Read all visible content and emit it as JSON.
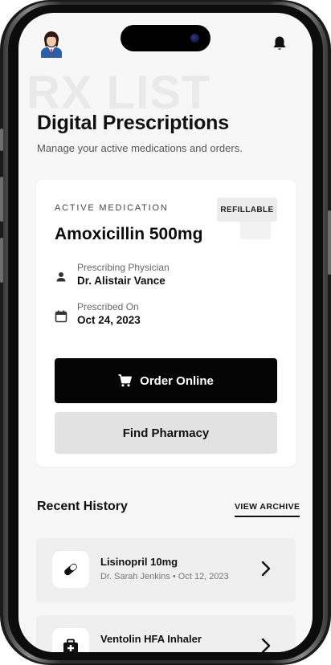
{
  "watermark": "RX LIST",
  "header": {
    "title": "Digital Prescriptions",
    "subtitle": "Manage your active medications and orders."
  },
  "active_card": {
    "eyebrow": "ACTIVE MEDICATION",
    "badge": "REFILLABLE",
    "medication": "Amoxicillin 500mg",
    "physician_label": "Prescribing Physician",
    "physician_value": "Dr. Alistair Vance",
    "date_label": "Prescribed On",
    "date_value": "Oct 24, 2023",
    "order_button": "Order Online",
    "pharmacy_button": "Find Pharmacy"
  },
  "history": {
    "title": "Recent History",
    "link": "VIEW ARCHIVE",
    "items": [
      {
        "name": "Lisinopril 10mg",
        "meta": "Dr. Sarah Jenkins • Oct 12, 2023",
        "icon": "pill-icon"
      },
      {
        "name": "Ventolin HFA Inhaler",
        "meta": "",
        "icon": "medical-kit-icon"
      }
    ]
  },
  "icons": {
    "profile": "doctor-avatar-icon",
    "notifications": "bell-icon",
    "physician": "person-icon",
    "date": "calendar-icon",
    "cart": "shopping-cart-icon",
    "chevron": "chevron-right-icon"
  },
  "colors": {
    "primary_button": "#050505",
    "secondary_button": "#e2e2e2",
    "screen_background": "#f7f7f7"
  }
}
